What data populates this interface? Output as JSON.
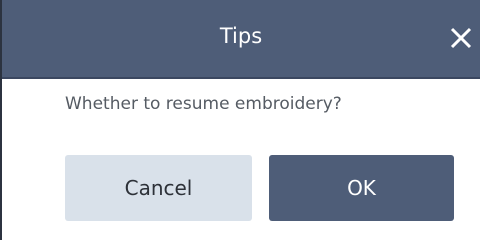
{
  "dialog": {
    "title": "Tips",
    "message": "Whether to resume embroidery?",
    "close_icon": "close-icon",
    "buttons": {
      "cancel_label": "Cancel",
      "ok_label": "OK"
    },
    "colors": {
      "header": "#4e5d78",
      "cancel_bg": "#d9e1ea",
      "ok_bg": "#4e5d78"
    }
  }
}
